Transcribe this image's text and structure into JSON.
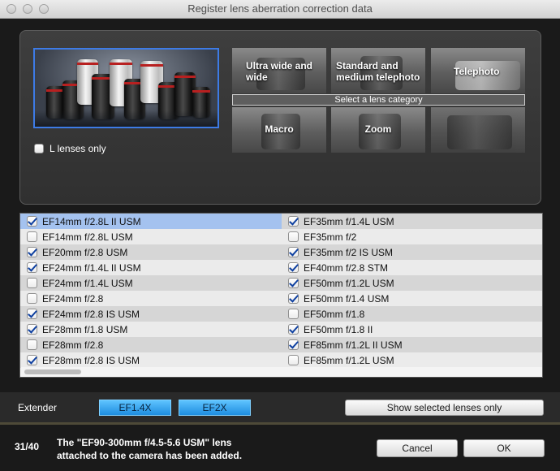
{
  "window": {
    "title": "Register lens aberration correction data"
  },
  "filter": {
    "l_lenses_only_label": "L lenses only",
    "l_lenses_only_checked": false
  },
  "categories": {
    "ultra_wide": "Ultra wide and wide",
    "standard": "Standard and medium telephoto",
    "telephoto": "Telephoto",
    "macro": "Macro",
    "zoom": "Zoom",
    "select_label": "Select a lens category"
  },
  "lens_list": {
    "left": [
      {
        "name": "EF14mm f/2.8L II USM",
        "checked": true,
        "selected": true
      },
      {
        "name": "EF14mm f/2.8L USM",
        "checked": false
      },
      {
        "name": "EF20mm f/2.8 USM",
        "checked": true
      },
      {
        "name": "EF24mm f/1.4L II USM",
        "checked": true
      },
      {
        "name": "EF24mm f/1.4L USM",
        "checked": false
      },
      {
        "name": "EF24mm f/2.8",
        "checked": false
      },
      {
        "name": "EF24mm f/2.8 IS USM",
        "checked": true
      },
      {
        "name": "EF28mm f/1.8 USM",
        "checked": true
      },
      {
        "name": "EF28mm f/2.8",
        "checked": false
      },
      {
        "name": "EF28mm f/2.8 IS USM",
        "checked": true
      }
    ],
    "right": [
      {
        "name": "EF35mm f/1.4L USM",
        "checked": true
      },
      {
        "name": "EF35mm f/2",
        "checked": false
      },
      {
        "name": "EF35mm f/2 IS USM",
        "checked": true
      },
      {
        "name": "EF40mm f/2.8 STM",
        "checked": true
      },
      {
        "name": "EF50mm f/1.2L USM",
        "checked": true
      },
      {
        "name": "EF50mm f/1.4 USM",
        "checked": true
      },
      {
        "name": "EF50mm f/1.8",
        "checked": false
      },
      {
        "name": "EF50mm f/1.8 II",
        "checked": true
      },
      {
        "name": "EF85mm f/1.2L II USM",
        "checked": true
      },
      {
        "name": "EF85mm f/1.2L USM",
        "checked": false
      }
    ]
  },
  "extender": {
    "label": "Extender",
    "ef14x": "EF1.4X",
    "ef2x": "EF2X",
    "show_selected": "Show selected lenses only"
  },
  "footer": {
    "counter": "31/40",
    "message_line1": "The \"EF90-300mm f/4.5-5.6 USM\" lens",
    "message_line2": "attached to the camera has been added.",
    "cancel": "Cancel",
    "ok": "OK"
  },
  "colors": {
    "accent_blue": "#1e8de0",
    "selection": "#a4c2ef",
    "hero_border": "#3d7be6"
  }
}
